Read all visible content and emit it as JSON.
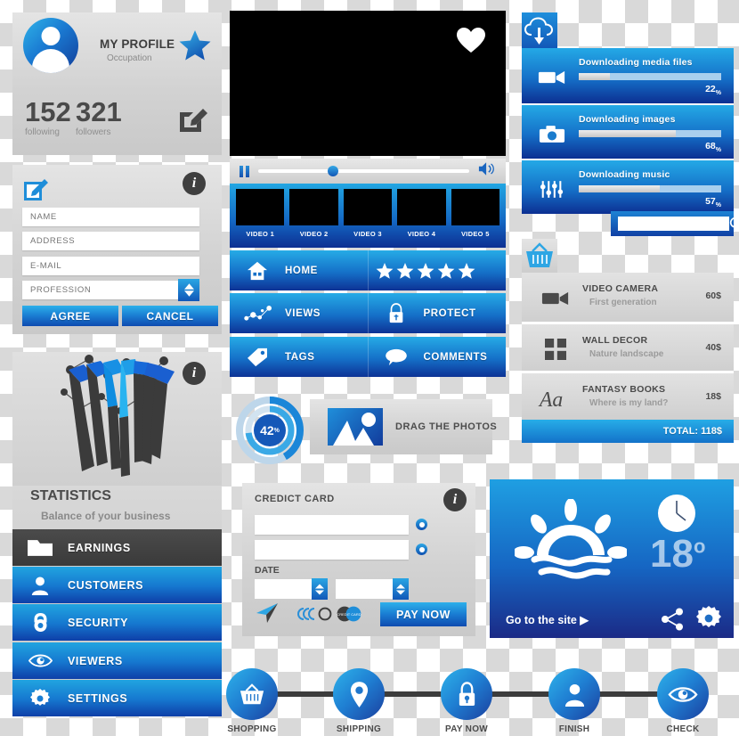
{
  "profile": {
    "title": "MY PROFILE",
    "occupation": "Occupation",
    "following_count": "152",
    "following_label": "following",
    "followers_count": "321",
    "followers_label": "followers",
    "star_icon": "star-icon",
    "edit_icon": "edit-pencil-icon",
    "avatar_icon": "user-avatar-icon"
  },
  "form": {
    "info_glyph": "i",
    "edit_icon": "edit-pencil-icon",
    "fields": [
      {
        "name": "name",
        "placeholder": "NAME",
        "value": ""
      },
      {
        "name": "address",
        "placeholder": "ADDRESS",
        "value": ""
      },
      {
        "name": "email",
        "placeholder": "E-MAIL",
        "value": ""
      }
    ],
    "profession": {
      "placeholder": "PROFESSION",
      "value": ""
    },
    "agree_label": "AGREE",
    "cancel_label": "CANCEL"
  },
  "statistics": {
    "info_glyph": "i",
    "title": "STATISTICS",
    "subtitle": "Balance of your business",
    "menu": [
      {
        "label": "EARNINGS",
        "icon": "folder-icon",
        "active": true
      },
      {
        "label": "CUSTOMERS",
        "icon": "user-icon",
        "active": false
      },
      {
        "label": "SECURITY",
        "icon": "lock-icon",
        "active": false
      },
      {
        "label": "VIEWERS",
        "icon": "eye-icon",
        "active": false
      },
      {
        "label": "SETTINGS",
        "icon": "gear-icon",
        "active": false
      }
    ]
  },
  "video": {
    "heart_icon": "heart-icon",
    "pause_icon": "pause-icon",
    "volume_icon": "volume-icon",
    "progress_percent": 33,
    "thumbnails": [
      {
        "label": "VIDEO 1"
      },
      {
        "label": "VIDEO 2"
      },
      {
        "label": "VIDEO 3"
      },
      {
        "label": "VIDEO 4"
      },
      {
        "label": "VIDEO 5"
      }
    ],
    "tiles": [
      {
        "label": "HOME",
        "icon": "home-icon"
      },
      {
        "label": "",
        "icon": "star-rating-icon",
        "rating": 5
      },
      {
        "label": "VIEWS",
        "icon": "network-dots-icon"
      },
      {
        "label": "PROTECT",
        "icon": "padlock-icon"
      },
      {
        "label": "TAGS",
        "icon": "tag-icon"
      },
      {
        "label": "COMMENTS",
        "icon": "speech-bubble-icon"
      }
    ]
  },
  "upload": {
    "progress_value": "42",
    "progress_unit": "%",
    "progress_percent": 42,
    "drag_label": "DRAG THE PHOTOS",
    "thumb_icon": "image-mountain-icon"
  },
  "credit_card": {
    "title": "CREDICT CARD",
    "info_glyph": "i",
    "card_number_value": "",
    "card_holder_value": "",
    "date_label": "DATE",
    "date_month_value": "",
    "date_year_value": "",
    "pay_label": "PAY NOW",
    "payment_icons": [
      "paper-plane-icon",
      "rings-logo-icon",
      "credit-card-logo-icon"
    ],
    "card_logo_text": "CREDIT CARD"
  },
  "downloads": {
    "tab_icon": "cloud-download-icon",
    "items": [
      {
        "title": "Downloading media files",
        "percent": 22,
        "percent_label": "22",
        "unit": "%",
        "icon": "video-camera-icon"
      },
      {
        "title": "Downloading images",
        "percent": 68,
        "percent_label": "68",
        "unit": "%",
        "icon": "photo-camera-icon"
      },
      {
        "title": "Downloading music",
        "percent": 57,
        "percent_label": "57",
        "unit": "%",
        "icon": "equalizer-icon"
      }
    ],
    "search_placeholder": "",
    "search_value": "",
    "search_icon": "magnifier-icon"
  },
  "cart": {
    "tab_icon": "shopping-basket-icon",
    "items": [
      {
        "name": "VIDEO CAMERA",
        "desc": "First generation",
        "price": "60$",
        "icon": "video-camera-icon"
      },
      {
        "name": "WALL DECOR",
        "desc": "Nature landscape",
        "price": "40$",
        "icon": "grid-squares-icon"
      },
      {
        "name": "FANTASY BOOKS",
        "desc": "Where is my land?",
        "price": "18$",
        "icon": "font-aa-icon"
      }
    ],
    "total_label": "TOTAL: 118$"
  },
  "weather": {
    "sun_icon": "sunrise-waves-icon",
    "clock_icon": "clock-icon",
    "temperature": "18",
    "degree_symbol": "o",
    "site_link": "Go to the site",
    "site_arrow": "▶",
    "share_icon": "share-nodes-icon",
    "gear_icon": "gear-icon"
  },
  "steps": [
    {
      "label": "SHOPPING",
      "icon": "shopping-basket-icon"
    },
    {
      "label": "SHIPPING",
      "icon": "map-pin-icon"
    },
    {
      "label": "PAY NOW",
      "icon": "padlock-icon"
    },
    {
      "label": "FINISH",
      "icon": "user-icon"
    },
    {
      "label": "CHECK",
      "icon": "eye-icon"
    }
  ],
  "colors": {
    "accent_light": "#2db0ea",
    "accent_mid": "#1a7ed3",
    "accent_dark": "#0f3f9e",
    "panel_grey": "#d9d9d9",
    "dark_grey": "#3f3f3f"
  }
}
